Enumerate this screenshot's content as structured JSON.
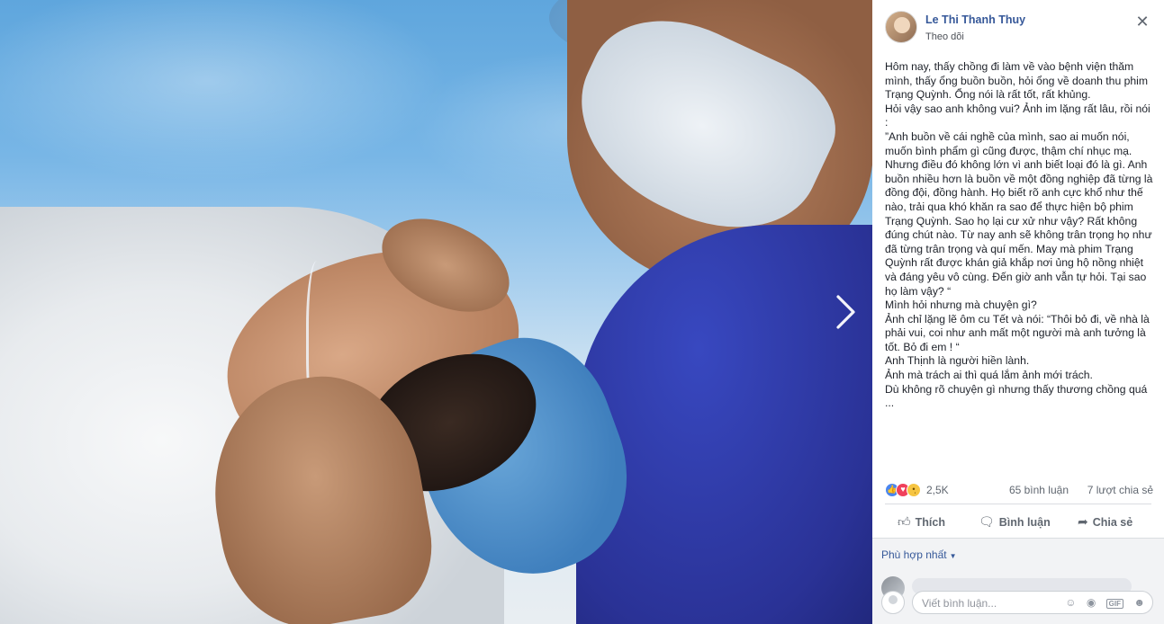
{
  "post": {
    "author": "Le Thi Thanh Thuy",
    "follow_label": "Theo dõi",
    "paragraphs": [
      "Hôm nay, thấy chồng đi làm về vào bệnh viện thăm mình, thấy ổng buồn buồn, hỏi ổng về doanh thu phim Trạng Quỳnh. Ổng nói là rất tốt, rất khủng.",
      "Hỏi vậy sao anh không vui? Ảnh im lặng rất lâu, rồi nói :",
      "”Anh buồn về cái nghề của mình, sao ai muốn nói, muốn bình phẩm gì cũng được, thậm chí nhục mạ. Nhưng điều đó không lớn vì anh biết loại đó là gì. Anh buồn nhiều hơn là buồn về một đồng nghiệp đã từng là đồng đội, đồng hành. Họ biết rõ anh cực khổ như thế nào, trải qua khó khăn ra sao để thực hiện bộ phim Trạng Quỳnh. Sao họ lại cư xử như vậy? Rất không đúng chút nào. Từ nay anh sẽ không trân trọng họ như đã từng trân trọng và quí mến. May mà phim Trạng Quỳnh rất được khán giả khắp nơi ủng hộ nồng nhiệt và đáng yêu vô cùng. Đến giờ anh vẫn tự hỏi. Tại sao họ làm vậy? “",
      "Mình hỏi nhưng mà chuyện gì?",
      "Ảnh chỉ lặng lẽ ôm cu Tết và nói: “Thôi bỏ đi, về nhà là phải vui, coi như anh mất một người mà anh tưởng là tốt. Bỏ đi em ! “",
      "Anh Thịnh là người hiền lành.",
      "Ảnh mà trách ai thì quá lắm ảnh mới trách.",
      "Dù không rõ chuyện gì nhưng thấy thương chồng quá ..."
    ],
    "reaction_count": "2,5K",
    "comment_count": "65 bình luận",
    "share_count": "7 lượt chia sẻ"
  },
  "actions": {
    "like": "Thích",
    "comment": "Bình luận",
    "share": "Chia sẻ"
  },
  "comments": {
    "sort_label": "Phù hợp nhất",
    "input_placeholder": "Viết bình luận..."
  },
  "icons": {
    "close": "close-icon",
    "next": "chevron-right-icon",
    "like": "thumbs-up-icon",
    "comment": "speech-bubble-icon",
    "share": "share-arrow-icon",
    "emoji": "smiley-icon",
    "camera": "camera-icon",
    "gif": "gif-icon",
    "sticker": "sticker-icon"
  },
  "colors": {
    "link_blue": "#365899",
    "text": "#1d2129",
    "meta": "#606770",
    "like_blue": "#4a86f0",
    "love_red": "#f0415b",
    "sad_yellow": "#f6c542"
  }
}
